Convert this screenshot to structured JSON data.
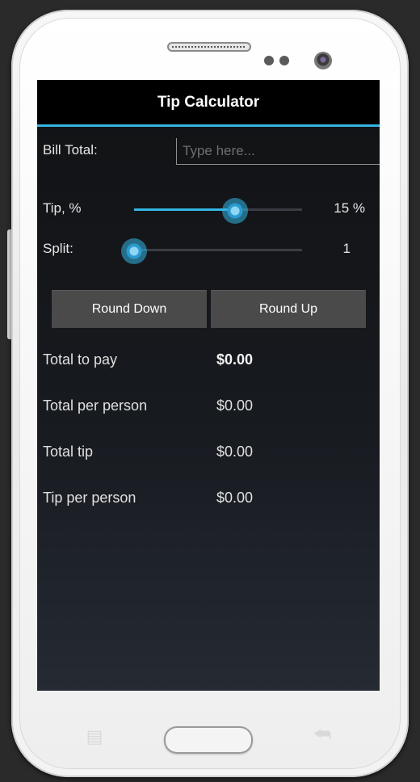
{
  "app": {
    "title": "Tip Calculator"
  },
  "bill": {
    "label": "Bill Total:",
    "placeholder": "Type here...",
    "value": ""
  },
  "tip": {
    "label": "Tip, %",
    "value": 15,
    "display": "15 %",
    "slider_fraction": 0.6
  },
  "split": {
    "label": "Split:",
    "value": 1,
    "display": "1",
    "slider_fraction": 0.0
  },
  "buttons": {
    "round_down": "Round Down",
    "round_up": "Round Up"
  },
  "results": [
    {
      "label": "Total to pay",
      "value": "$0.00",
      "bold": true
    },
    {
      "label": "Total per person",
      "value": "$0.00",
      "bold": false
    },
    {
      "label": "Total tip",
      "value": "$0.00",
      "bold": false
    },
    {
      "label": "Tip per person",
      "value": "$0.00",
      "bold": false
    }
  ],
  "colors": {
    "accent": "#33b5e5",
    "titlebar": "#000000",
    "button": "#4a4a4a"
  },
  "icons": [
    "menu-key-icon",
    "home-button",
    "back-key-icon",
    "front-camera-icon",
    "earpiece-speaker-icon"
  ]
}
